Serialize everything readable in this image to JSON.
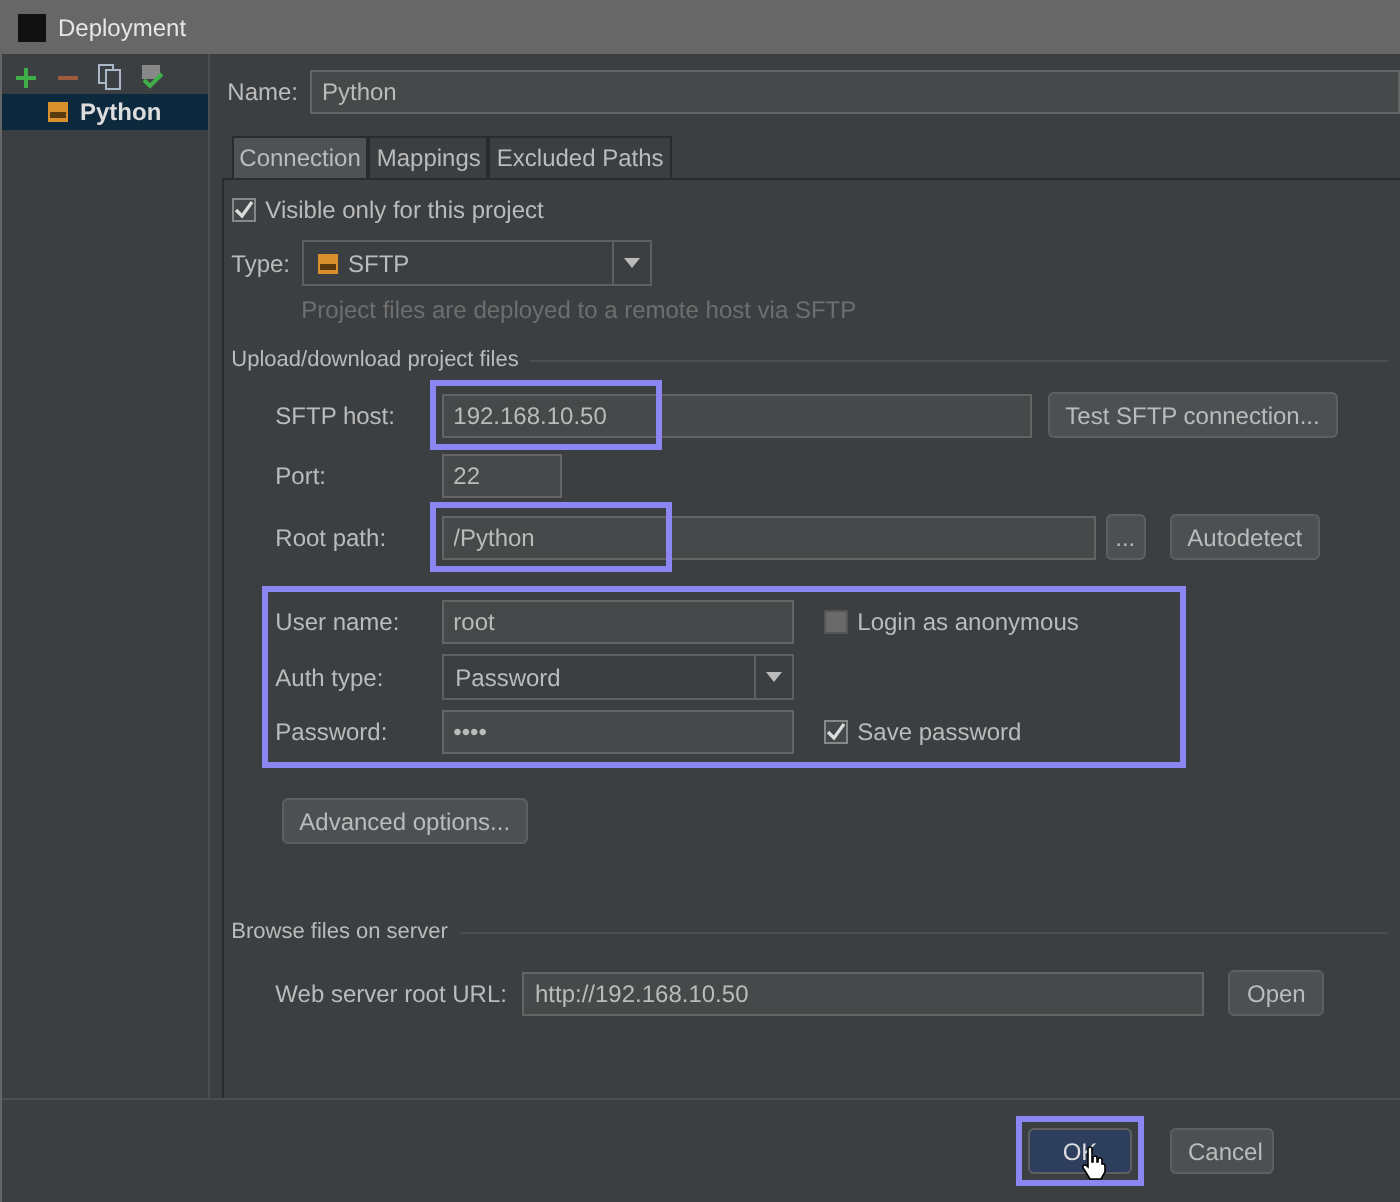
{
  "window": {
    "title": "Deployment"
  },
  "sidebar": {
    "toolbar": [
      {
        "kind": "add"
      },
      {
        "kind": "remove"
      },
      {
        "kind": "copy"
      },
      {
        "kind": "default"
      }
    ],
    "items": [
      {
        "label": "Python",
        "selected": true
      }
    ]
  },
  "name": {
    "label": "Name:",
    "value": "Python"
  },
  "tabs": [
    {
      "label": "Connection",
      "selected": true
    },
    {
      "label": "Mappings",
      "selected": false
    },
    {
      "label": "Excluded Paths",
      "selected": false
    }
  ],
  "visible_only": {
    "label": "Visible only for this project",
    "checked": true
  },
  "type": {
    "label": "Type:",
    "value": "SFTP",
    "hint": "Project files are deployed to a remote host via SFTP"
  },
  "upload_section": {
    "title": "Upload/download project files",
    "host": {
      "label": "SFTP host:",
      "value": "192.168.10.50",
      "highlighted": true,
      "button": "Test SFTP connection..."
    },
    "port": {
      "label": "Port:",
      "value": "22"
    },
    "root_path": {
      "label": "Root path:",
      "value": "/Python",
      "highlighted": true,
      "browse_button": "...",
      "button": "Autodetect"
    },
    "credentials": {
      "highlighted": true,
      "user_name": {
        "label": "User name:",
        "value": "root"
      },
      "anonymous": {
        "label": "Login as anonymous",
        "checked": false
      },
      "auth_type": {
        "label": "Auth type:",
        "value": "Password"
      },
      "password": {
        "label": "Password:",
        "value": "••••"
      },
      "save_password": {
        "label": "Save password",
        "checked": true
      }
    },
    "advanced_button": "Advanced options..."
  },
  "browse_section": {
    "title": "Browse files on server",
    "web_root": {
      "label": "Web server root URL:",
      "value": "http://192.168.10.50",
      "button": "Open"
    }
  },
  "buttons": [
    {
      "label": "OK",
      "default": true,
      "highlighted": true
    },
    {
      "label": "Cancel",
      "default": false,
      "highlighted": false
    }
  ]
}
